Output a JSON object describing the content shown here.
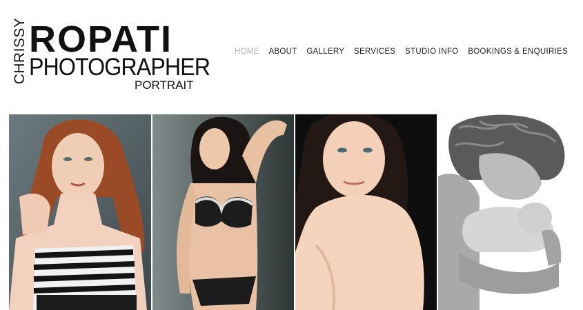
{
  "logo": {
    "first_name": "CHRISSY",
    "last_name": "ROPATI",
    "title": "PHOTOGRAPHER",
    "tagline": "PORTRAIT"
  },
  "nav": {
    "items": [
      {
        "label": "HOME",
        "active": true
      },
      {
        "label": "ABOUT",
        "active": false
      },
      {
        "label": "GALLERY",
        "active": false
      },
      {
        "label": "SERVICES",
        "active": false
      },
      {
        "label": "STUDIO INFO",
        "active": false
      },
      {
        "label": "BOOKINGS & ENQUIRIES",
        "active": false
      }
    ]
  },
  "gallery": {
    "photos": [
      {
        "subject": "redhead woman in striped strapless top"
      },
      {
        "subject": "woman in black and white lingerie"
      },
      {
        "subject": "dark haired woman bare shoulder"
      },
      {
        "subject": "black and white father holding newborn"
      }
    ]
  },
  "colors": {
    "nav_active": "#b5b5b5",
    "nav_text": "#222222",
    "logo_text": "#111111",
    "background": "#ffffff"
  }
}
